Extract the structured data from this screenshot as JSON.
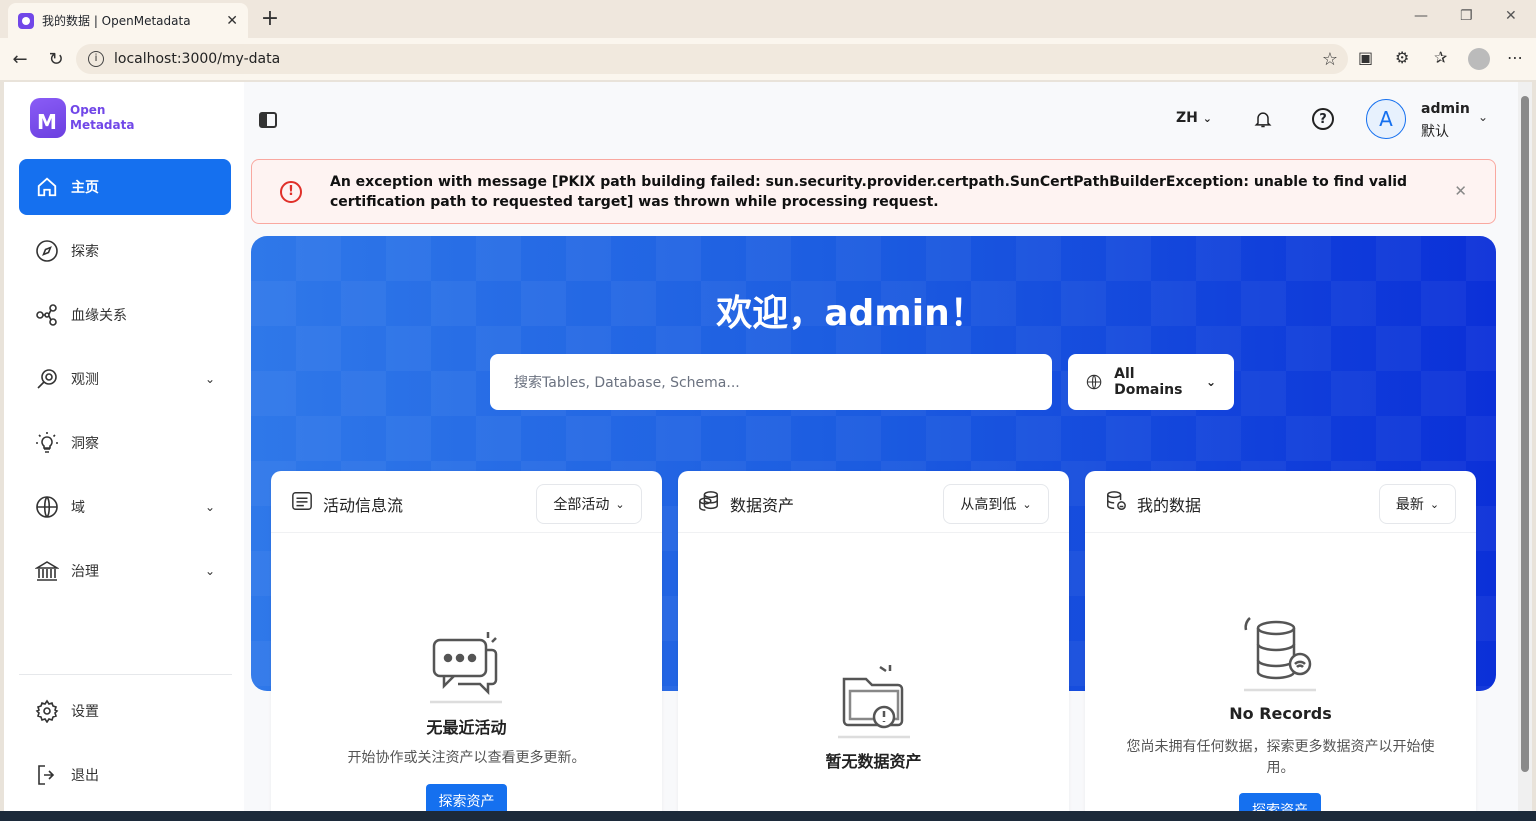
{
  "browser": {
    "tab_title": "我的数据 | OpenMetadata",
    "url": "localhost:3000/my-data"
  },
  "sidebar": {
    "logo_line1": "Open",
    "logo_line2": "Metadata",
    "items": [
      {
        "label": "主页"
      },
      {
        "label": "探索"
      },
      {
        "label": "血缘关系"
      },
      {
        "label": "观测"
      },
      {
        "label": "洞察"
      },
      {
        "label": "域"
      },
      {
        "label": "治理"
      }
    ],
    "bottom_items": [
      {
        "label": "设置"
      },
      {
        "label": "退出"
      }
    ]
  },
  "topbar": {
    "language": "ZH",
    "user_initial": "A",
    "user_name": "admin",
    "user_role": "默认"
  },
  "alert": {
    "message": "An exception with message [PKIX path building failed: sun.security.provider.certpath.SunCertPathBuilderException: unable to find valid certification path to requested target] was thrown while processing request."
  },
  "hero": {
    "title": "欢迎，admin！",
    "search_placeholder": "搜索Tables, Database, Schema...",
    "domain_label": "All Domains"
  },
  "cards": [
    {
      "title": "活动信息流",
      "dropdown": "全部活动",
      "empty_title": "无最近活动",
      "empty_desc": "开始协作或关注资产以查看更多更新。",
      "button": "探索资产"
    },
    {
      "title": "数据资产",
      "dropdown": "从高到低",
      "empty_title": "暂无数据资产"
    },
    {
      "title": "我的数据",
      "dropdown": "最新",
      "empty_title": "No Records",
      "empty_desc": "您尚未拥有任何数据，探索更多数据资产以开始使用。",
      "button": "探索资产"
    }
  ],
  "colors": {
    "primary": "#1570ef",
    "alert_border": "#f9a8a0",
    "alert_bg": "#fef3f2",
    "brand": "#7147e8"
  }
}
